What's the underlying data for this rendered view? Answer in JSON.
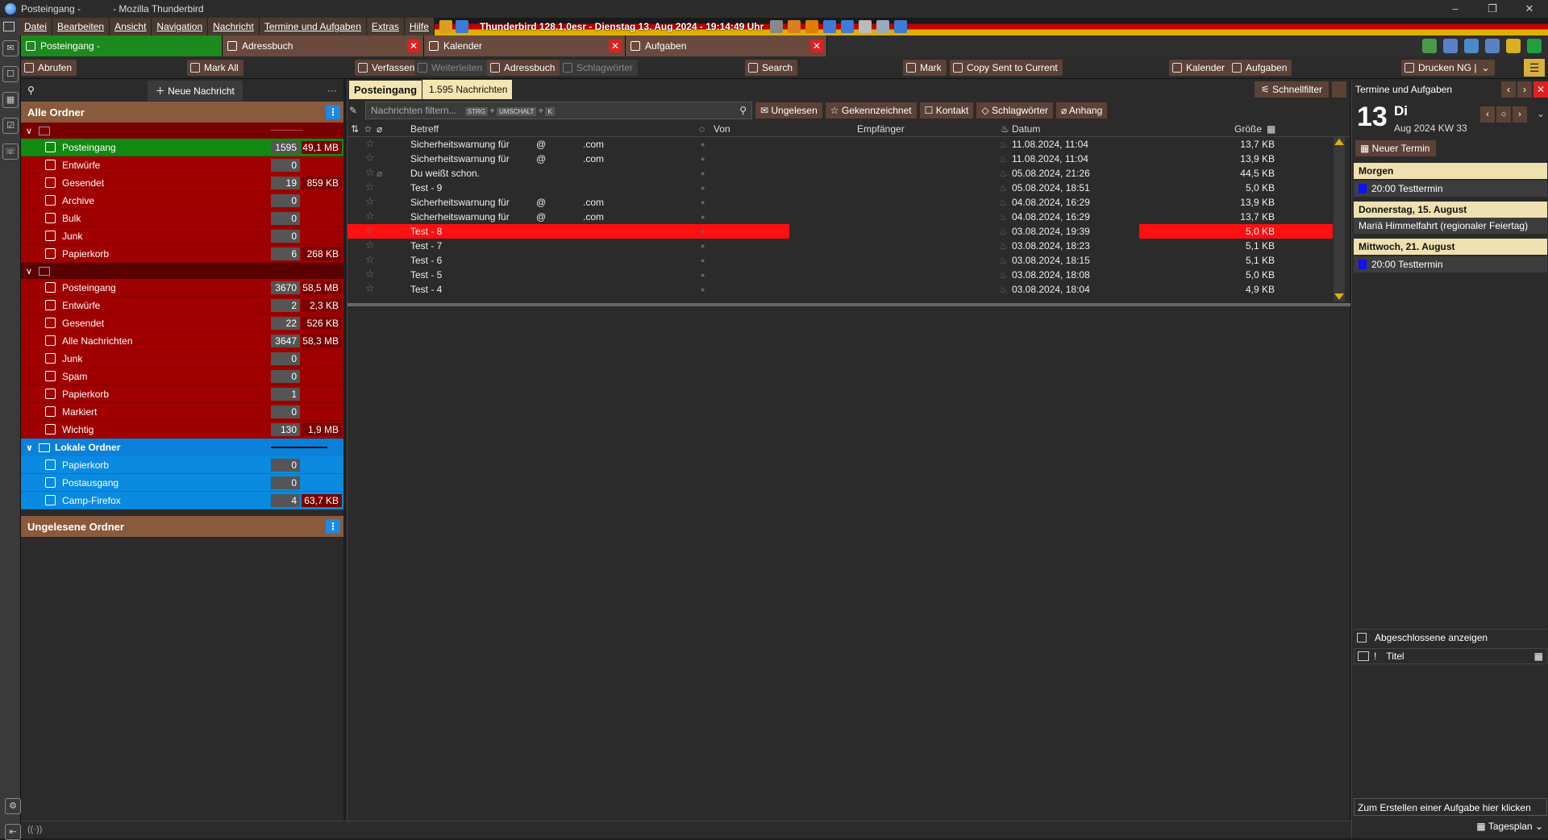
{
  "window": {
    "title": "Posteingang -",
    "app": "- Mozilla Thunderbird"
  },
  "menu": {
    "items": [
      "Datei",
      "Bearbeiten",
      "Ansicht",
      "Navigation",
      "Nachricht",
      "Termine und Aufgaben",
      "Extras",
      "Hilfe"
    ],
    "clock": "Thunderbird 128.1.0esr - Dienstag 13. Aug 2024 - 19:14:49 Uhr"
  },
  "tabs": [
    {
      "label": "Posteingang -"
    },
    {
      "label": "Adressbuch"
    },
    {
      "label": "Kalender"
    },
    {
      "label": "Aufgaben"
    }
  ],
  "toolbar": {
    "abrufen": "Abrufen",
    "mark_all": "Mark All",
    "verfassen": "Verfassen",
    "weiterleiten": "Weiterleiten",
    "adressbuch": "Adressbuch",
    "schlagwoerter": "Schlagwörter",
    "search": "Search",
    "mark": "Mark",
    "copy_sent": "Copy Sent to Current",
    "kalender": "Kalender",
    "aufgaben": "Aufgaben",
    "drucken": "Drucken NG |"
  },
  "folderpane": {
    "new_message": "Neue Nachricht",
    "section_all": "Alle Ordner",
    "section_unread": "Ungelesene Ordner",
    "account1": [
      {
        "name": "Posteingang",
        "count": "1595",
        "size": "49,1 MB",
        "style": "green"
      },
      {
        "name": "Entwürfe",
        "count": "0",
        "size": "",
        "style": "red"
      },
      {
        "name": "Gesendet",
        "count": "19",
        "size": "859 KB",
        "style": "red"
      },
      {
        "name": "Archive",
        "count": "0",
        "size": "",
        "style": "red"
      },
      {
        "name": "Bulk",
        "count": "0",
        "size": "",
        "style": "red"
      },
      {
        "name": "Junk",
        "count": "0",
        "size": "",
        "style": "red"
      },
      {
        "name": "Papierkorb",
        "count": "6",
        "size": "268 KB",
        "style": "red"
      }
    ],
    "account2": [
      {
        "name": "Posteingang",
        "count": "3670",
        "size": "58,5 MB"
      },
      {
        "name": "Entwürfe",
        "count": "2",
        "size": "2,3 KB"
      },
      {
        "name": "Gesendet",
        "count": "22",
        "size": "526 KB"
      },
      {
        "name": "Alle Nachrichten",
        "count": "3647",
        "size": "58,3 MB"
      },
      {
        "name": "Junk",
        "count": "0",
        "size": ""
      },
      {
        "name": "Spam",
        "count": "0",
        "size": ""
      },
      {
        "name": "Papierkorb",
        "count": "1",
        "size": ""
      },
      {
        "name": "Markiert",
        "count": "0",
        "size": ""
      },
      {
        "name": "Wichtig",
        "count": "130",
        "size": "1,9 MB"
      }
    ],
    "local_label": "Lokale Ordner",
    "local": [
      {
        "name": "Papierkorb",
        "count": "0",
        "size": ""
      },
      {
        "name": "Postausgang",
        "count": "0",
        "size": ""
      },
      {
        "name": "Camp-Firefox",
        "count": "4",
        "size": "63,7 KB"
      }
    ]
  },
  "threadpane": {
    "folder_name": "Posteingang",
    "message_count": "1.595 Nachrichten",
    "quickfilter": "Schnellfilter",
    "filter_placeholder": "Nachrichten filtern...",
    "kbd": [
      "STRG",
      "+",
      "UMSCHALT",
      "+",
      "K"
    ],
    "filters": [
      "Ungelesen",
      "Gekennzeichnet",
      "Kontakt",
      "Schlagwörter",
      "Anhang"
    ],
    "columns": {
      "subject": "Betreff",
      "from": "Von",
      "recipient": "Empfänger",
      "date": "Datum",
      "size": "Größe"
    },
    "messages": [
      {
        "subject": "Sicherheitswarnung für",
        "at": "@",
        "domain": ".com",
        "date": "11.08.2024, 11:04",
        "size": "13,7 KB",
        "selected": false
      },
      {
        "subject": "Sicherheitswarnung für",
        "at": "@",
        "domain": ".com",
        "date": "11.08.2024, 11:04",
        "size": "13,9 KB",
        "selected": false
      },
      {
        "subject": "Du weißt schon.",
        "at": "",
        "domain": "",
        "date": "05.08.2024, 21:26",
        "size": "44,5 KB",
        "selected": false
      },
      {
        "subject": "Test - 9",
        "at": "",
        "domain": "",
        "date": "05.08.2024, 18:51",
        "size": "5,0 KB",
        "selected": false
      },
      {
        "subject": "Sicherheitswarnung für",
        "at": "@",
        "domain": ".com",
        "date": "04.08.2024, 16:29",
        "size": "13,9 KB",
        "selected": false
      },
      {
        "subject": "Sicherheitswarnung für",
        "at": "@",
        "domain": ".com",
        "date": "04.08.2024, 16:29",
        "size": "13,7 KB",
        "selected": false
      },
      {
        "subject": "Test - 8",
        "at": "",
        "domain": "",
        "date": "03.08.2024, 19:39",
        "size": "5,0 KB",
        "selected": true
      },
      {
        "subject": "Test - 7",
        "at": "",
        "domain": "",
        "date": "03.08.2024, 18:23",
        "size": "5,1 KB",
        "selected": false
      },
      {
        "subject": "Test - 6",
        "at": "",
        "domain": "",
        "date": "03.08.2024, 18:15",
        "size": "5,1 KB",
        "selected": false
      },
      {
        "subject": "Test - 5",
        "at": "",
        "domain": "",
        "date": "03.08.2024, 18:08",
        "size": "5,0 KB",
        "selected": false
      },
      {
        "subject": "Test - 4",
        "at": "",
        "domain": "",
        "date": "03.08.2024, 18:04",
        "size": "4,9 KB",
        "selected": false
      }
    ]
  },
  "today": {
    "title": "Termine und Aufgaben",
    "day_number": "13",
    "day_name": "Di",
    "month_kw": "Aug 2024  KW 33",
    "new_event": "Neuer Termin",
    "agenda": [
      {
        "head": "Morgen",
        "item": "20:00  Testtermin",
        "dot": true
      },
      {
        "head": "Donnerstag, 15. August",
        "item": "Mariä Himmelfahrt (regionaler Feiertag)",
        "dot": false
      },
      {
        "head": "Mittwoch, 21. August",
        "item": "20:00  Testtermin",
        "dot": true
      }
    ],
    "show_completed": "Abgeschlossene anzeigen",
    "task_col_title": "Titel",
    "task_create": "Zum Erstellen einer Aufgabe hier klicken",
    "tagesplan": "Tagesplan"
  },
  "colors": {
    "folder_red": "#a00000",
    "folder_green": "#128a12",
    "folder_blue": "#0a8ae0",
    "selected_row": "#ff1010",
    "toolbar_brown": "#5c4136"
  }
}
